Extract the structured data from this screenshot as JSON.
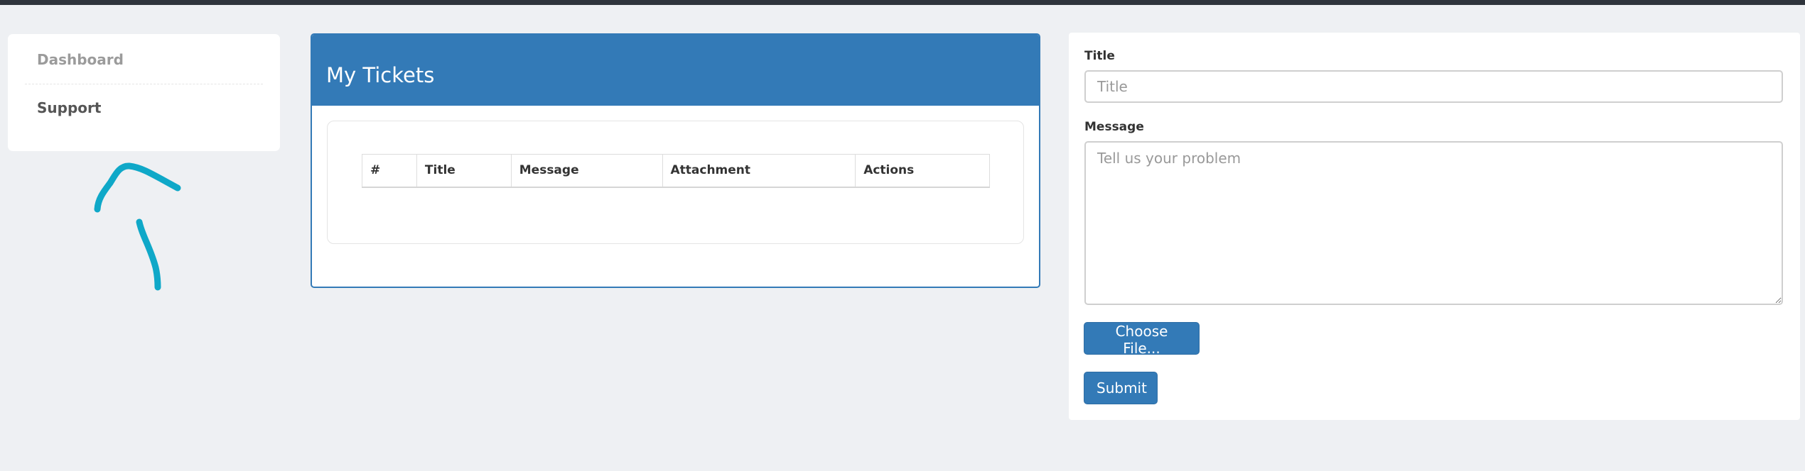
{
  "sidebar": {
    "items": [
      {
        "label": "Dashboard"
      },
      {
        "label": "Support"
      }
    ]
  },
  "tickets_panel": {
    "title": "My Tickets",
    "columns": [
      "#",
      "Title",
      "Message",
      "Attachment",
      "Actions"
    ],
    "rows": []
  },
  "ticket_form": {
    "title_label": "Title",
    "title_placeholder": "Title",
    "title_value": "",
    "message_label": "Message",
    "message_placeholder": "Tell us your problem",
    "message_value": "",
    "choose_file_label": "Choose File...",
    "submit_label": "Submit"
  },
  "colors": {
    "primary": "#337ab7",
    "background": "#eef0f3",
    "topbar": "#2f343c",
    "annotation": "#0fa8c8"
  }
}
